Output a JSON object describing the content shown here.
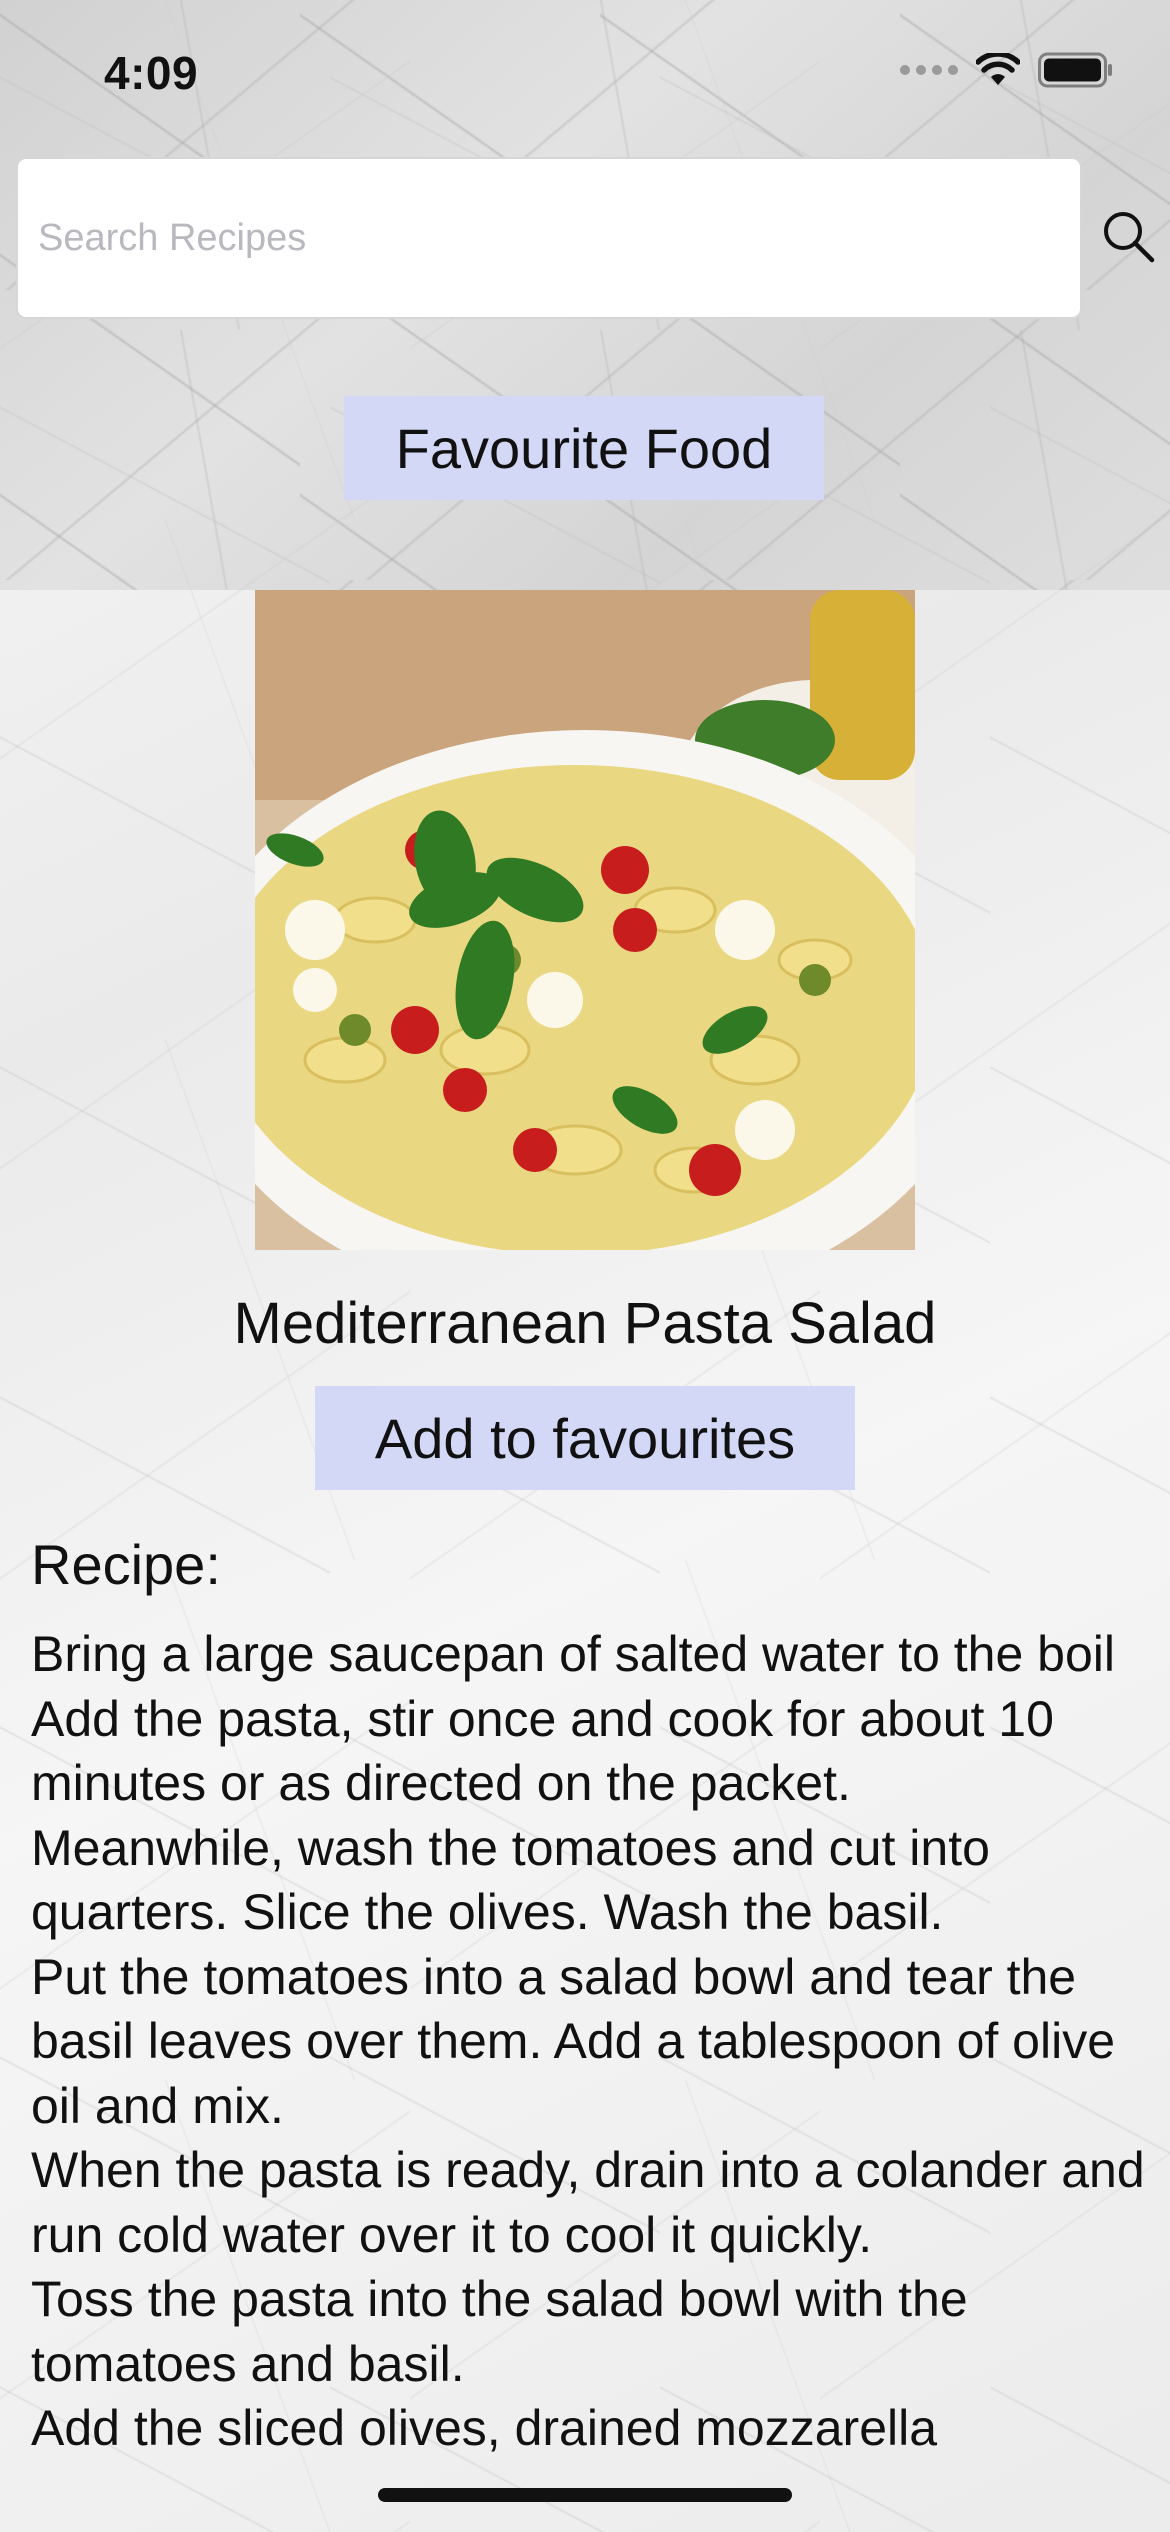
{
  "status_bar": {
    "time": "4:09",
    "icons": [
      "cellular-signal-icon",
      "wifi-icon",
      "battery-icon"
    ]
  },
  "search": {
    "placeholder": "Search Recipes",
    "icon": "magnifier-icon"
  },
  "header": {
    "favourite_food_label": "Favourite Food"
  },
  "dish": {
    "image": "pasta-salad-photo",
    "title": "Mediterranean Pasta Salad",
    "add_to_favourites_label": "Add to favourites"
  },
  "recipe": {
    "heading": "Recipe:",
    "steps": [
      "Bring a large saucepan of salted water to the boil",
      "Add the pasta, stir once and cook for about 10 minutes or as directed on the packet.",
      "Meanwhile, wash the tomatoes and cut into quarters. Slice the olives. Wash the basil.",
      "Put the tomatoes into a salad bowl and tear the basil leaves over them. Add a tablespoon of olive oil and mix.",
      "When the pasta is ready, drain into a colander and run cold water over it to cool it quickly.",
      "Toss the pasta into the salad bowl with the tomatoes and basil.",
      "Add the sliced olives, drained mozzarella"
    ]
  },
  "colors": {
    "button_bg": "#d3d8f6",
    "search_bg": "#ffffff",
    "text": "#111111"
  }
}
